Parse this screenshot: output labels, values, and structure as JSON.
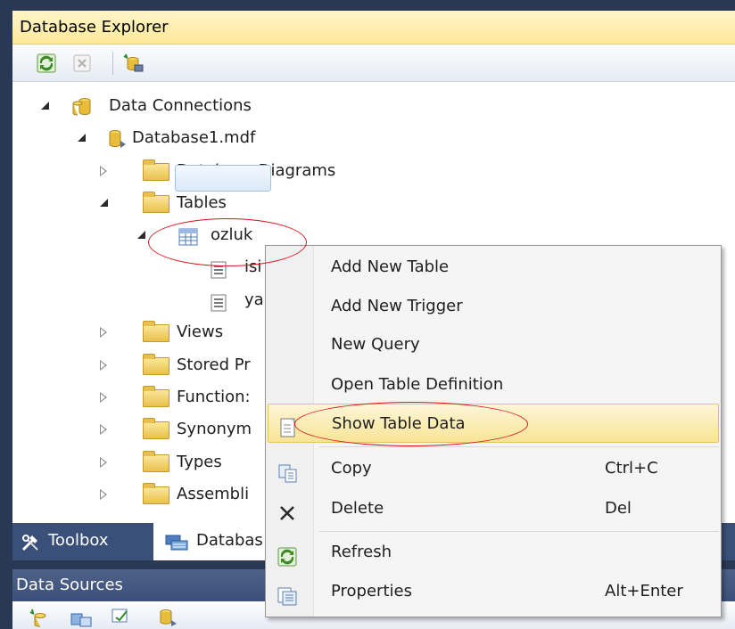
{
  "panel_title": "Database Explorer",
  "tree": {
    "data_connections": "Data Connections",
    "database": "Database1.mdf",
    "database_diagrams": "Database Diagrams",
    "tables": "Tables",
    "table_ozluk": "ozluk",
    "column_1_partial": "isi",
    "column_2_partial": "ya",
    "views": "Views",
    "stored_procedures_partial": "Stored Pr",
    "functions_partial": "Function:",
    "synonyms_partial": "Synonym",
    "types": "Types",
    "assemblies_partial": "Assembli"
  },
  "bottom_tabs": {
    "toolbox": "Toolbox",
    "database_explorer_partial": "Databas"
  },
  "data_sources_title": "Data Sources",
  "context_menu": {
    "add_new_table": "Add New Table",
    "add_new_trigger": "Add New Trigger",
    "new_query": "New Query",
    "open_table_definition": "Open Table Definition",
    "show_table_data": "Show Table Data",
    "copy": "Copy",
    "copy_shortcut": "Ctrl+C",
    "delete": "Delete",
    "delete_shortcut": "Del",
    "refresh": "Refresh",
    "properties": "Properties",
    "properties_shortcut": "Alt+Enter"
  },
  "colors": {
    "title_bar": "#fde89a",
    "frame": "#293955",
    "annotation": "#d8141b",
    "highlight": "#f9e496"
  }
}
